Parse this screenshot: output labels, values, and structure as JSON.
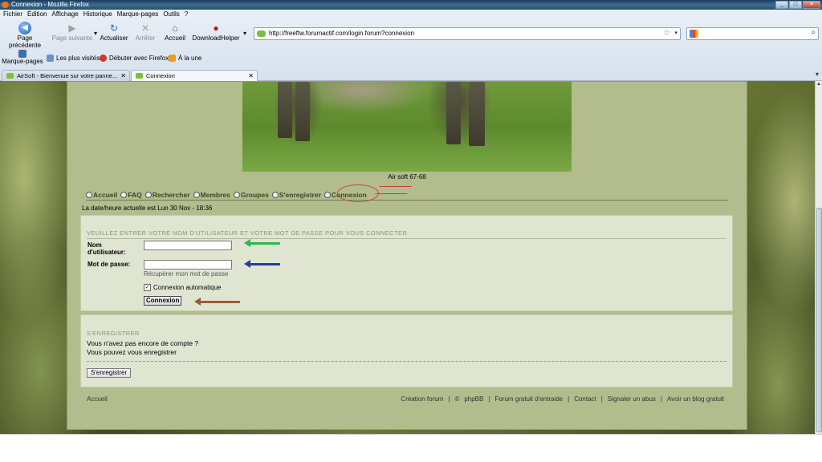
{
  "window": {
    "title": "Connexion - Mozilla Firefox"
  },
  "menu": [
    "Fichier",
    "Édition",
    "Affichage",
    "Historique",
    "Marque-pages",
    "Outils",
    "?"
  ],
  "nav": {
    "back": "Page précédente",
    "forward": "Page suivante",
    "reload": "Actualiser",
    "stop": "Arrêter",
    "home": "Accueil",
    "downloadhelper": "DownloadHelper"
  },
  "url": "http://freeftw.forumactif.com/login.forum?connexion",
  "bookmarks": {
    "marque_pages": "Marque-pages",
    "items": [
      "Les plus visités",
      "Débuter avec Firefox",
      "À la une"
    ]
  },
  "tabs": [
    {
      "label": "AirSoft - Bienvenue sur votre panne...",
      "active": false
    },
    {
      "label": "Connexion",
      "active": true
    }
  ],
  "page": {
    "caption": "Air soft 67-68",
    "nav": [
      "Accueil",
      "FAQ",
      "Rechercher",
      "Membres",
      "Groupes",
      "S'enregistrer",
      "Connexion"
    ],
    "date": "La date/heure actuelle est Lun 30 Nov - 18:36",
    "login_title": "VEUILLEZ ENTRER VOTRE NOM D'UTILISATEUR ET VOTRE MOT DE PASSE POUR VOUS CONNECTER.",
    "username_label": "Nom d'utilisateur:",
    "password_label": "Mot de passe:",
    "forgot": "Récupérer mon mot de passe",
    "auto_login": "Connexion automatique",
    "auto_login_checked": true,
    "login_button": "Connexion",
    "register_title": "S'ENREGISTRER",
    "register_l1": "Vous n'avez pas encore de compte ?",
    "register_l2": "Vous pouvez vous enregistrer",
    "register_button": "S'enregistrer",
    "footer_left": "Accueil",
    "footer_links": [
      "Création forum",
      "|",
      "©",
      "phpBB",
      "|",
      "Forum gratuit d'entraide",
      "|",
      "Contact",
      "|",
      "Signaler un abus",
      "|",
      "Avoir un blog gratuit"
    ]
  }
}
